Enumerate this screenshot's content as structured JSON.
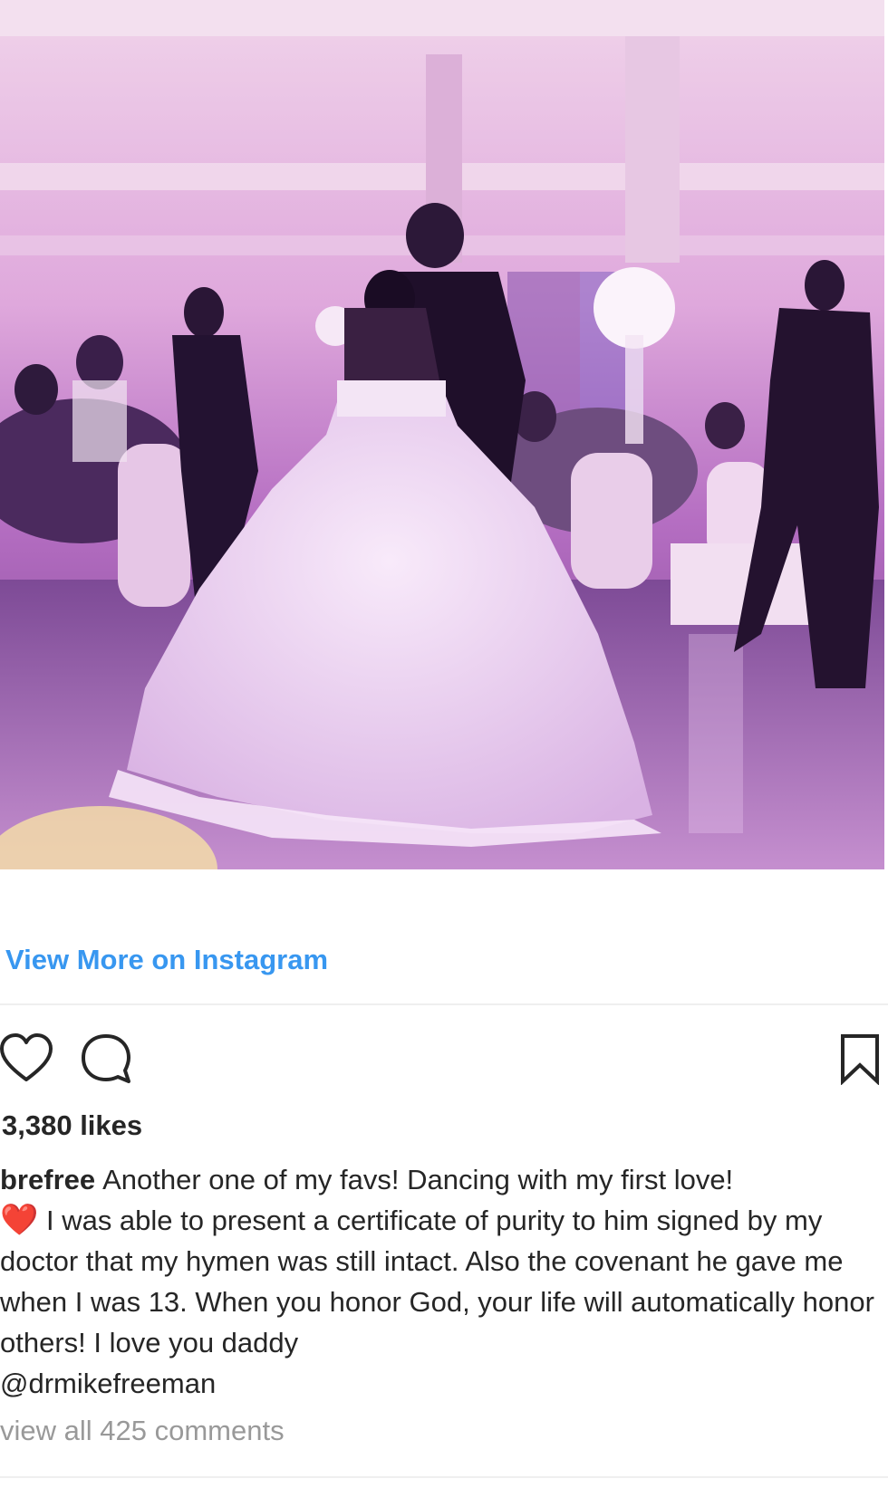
{
  "post": {
    "view_more_label": "View More on Instagram",
    "likes_label": "3,380 likes",
    "username": "brefree",
    "caption_line1": "Another one of my favs! Dancing with my first love!",
    "heart_emoji": "❤️",
    "caption_rest": "I was able to present a certificate of purity to him signed by my doctor that my hymen was still intact. Also the covenant he gave me when I was 13. When you honor God, your life will automatically honor others! I love you daddy",
    "mention": "@drmikefreeman",
    "comments_label": "view all 425 comments"
  },
  "icons": {
    "like": "heart-outline-icon",
    "comment": "speech-bubble-icon",
    "save": "bookmark-icon"
  },
  "colors": {
    "link": "#3897f0",
    "text": "#262626",
    "muted": "#999999",
    "separator": "#efefef"
  }
}
